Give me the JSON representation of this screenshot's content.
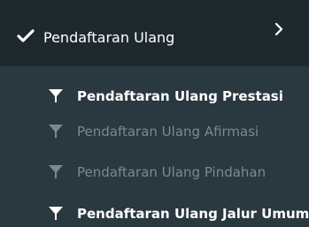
{
  "menu": {
    "title": "Pendaftaran Ulang",
    "icon": "check-icon",
    "chevron": "chevron-right-icon",
    "items": [
      {
        "label": "Pendaftaran Ulang Prestasi",
        "state": "active",
        "icon": "filter-icon"
      },
      {
        "label": "Pendaftaran Ulang Afirmasi",
        "state": "inactive",
        "icon": "filter-icon"
      },
      {
        "label": "Pendaftaran Ulang Pindahan",
        "state": "inactive",
        "icon": "filter-icon"
      },
      {
        "label": "Pendaftaran Ulang Jalur Umum",
        "state": "active",
        "icon": "filter-icon"
      }
    ]
  },
  "colors": {
    "header_bg": "#1e292e",
    "submenu_bg": "#2a383f",
    "active_text": "#ffffff",
    "inactive_text": "#7c8a8f"
  }
}
